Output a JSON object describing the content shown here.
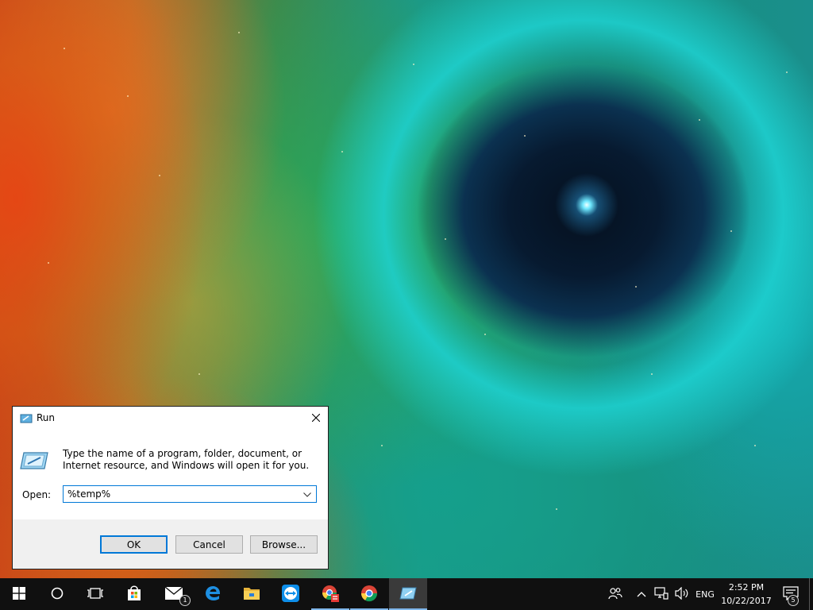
{
  "run_dialog": {
    "title": "Run",
    "description": "Type the name of a program, folder, document, or Internet resource, and Windows will open it for you.",
    "open_label": "Open:",
    "open_value": "%temp%",
    "buttons": {
      "ok": "OK",
      "cancel": "Cancel",
      "browse": "Browse..."
    }
  },
  "taskbar": {
    "apps": [
      {
        "name": "Mail",
        "icon": "mail-icon",
        "badge": "1"
      },
      {
        "name": "Microsoft Edge",
        "icon": "edge-icon"
      },
      {
        "name": "File Explorer",
        "icon": "folder-icon"
      },
      {
        "name": "TeamViewer",
        "icon": "teamviewer-icon"
      },
      {
        "name": "Chrome App",
        "icon": "chrome-app-icon"
      },
      {
        "name": "Google Chrome",
        "icon": "chrome-icon"
      },
      {
        "name": "Run",
        "icon": "run-icon",
        "active": true
      }
    ],
    "tray": {
      "language": "ENG",
      "time": "2:52 PM",
      "date": "10/22/2017",
      "notification_count": "5"
    }
  },
  "colors": {
    "accent": "#0078d7",
    "taskbar": "#101010",
    "active_underline": "#7fb6ea"
  }
}
